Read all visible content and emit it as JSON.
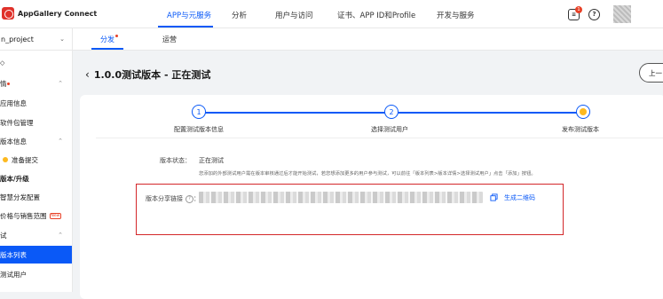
{
  "header": {
    "logo_text": "AppGallery Connect",
    "nav": [
      "APP与元服务",
      "分析",
      "用户与访问",
      "证书、APP ID和Profile",
      "开发与服务"
    ],
    "notification_count": "1",
    "help_glyph": "?"
  },
  "subbar": {
    "project": "n_project",
    "tabs": [
      "分发",
      "运营"
    ]
  },
  "sidebar": {
    "items": [
      "",
      "情",
      "应用信息",
      "软件包管理",
      "版本信息",
      "准备提交",
      "版本/升级",
      "智慧分发配置",
      "价格与销售范围",
      "试",
      "版本列表",
      "测试用户"
    ],
    "new_tag": "New"
  },
  "page": {
    "back_glyph": "‹",
    "title": "1.0.0测试版本 - 正在测试",
    "top_button": "上一"
  },
  "steps": [
    {
      "number": "1",
      "label": "配置测试版本信息"
    },
    {
      "number": "2",
      "label": "选择测试用户"
    },
    {
      "number": "",
      "label": "发布测试版本"
    }
  ],
  "details": {
    "status_label": "版本状态：",
    "status_value": "正在测试",
    "hint": "您添加的外部测试用户需在版本审核通过后才能开始测试，若您想添加更多的用户参与测试，可以前往「版本列表>版本详情>选择测试用户」点击「添加」按钮。",
    "share_label": "版本分享链接",
    "share_colon": "：",
    "qr_link": "生成二维码"
  },
  "colors": {
    "accent": "#0a59f7",
    "highlight_box": "#d3272a",
    "pending": "#fdb920"
  }
}
